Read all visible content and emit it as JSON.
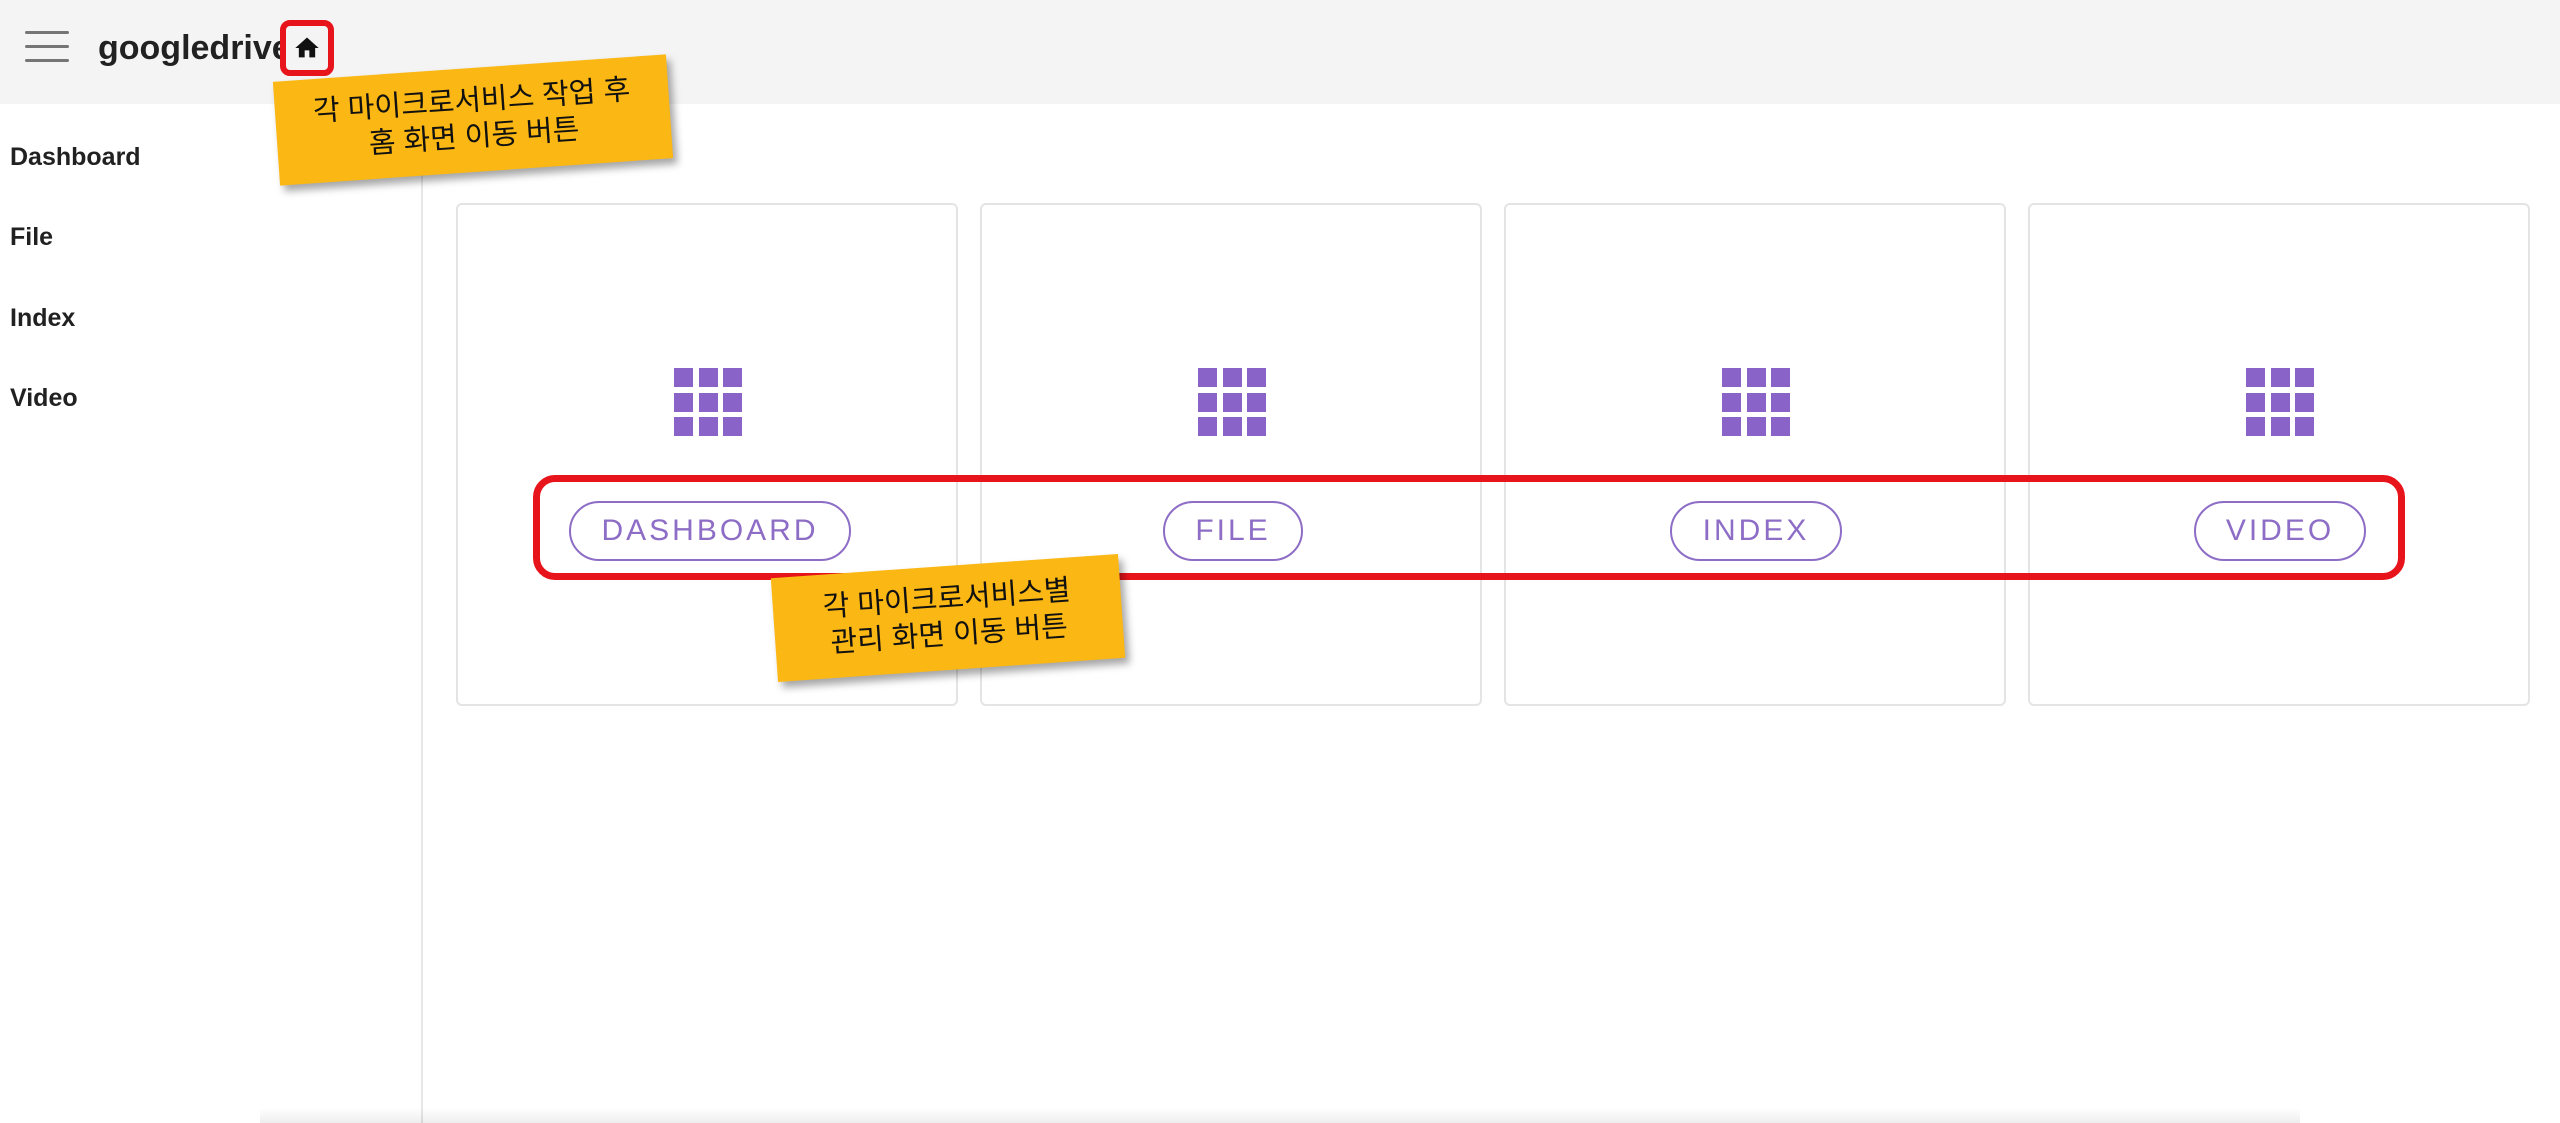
{
  "app": {
    "title": "googledrive"
  },
  "header": {
    "menu_icon": "hamburger-menu-icon",
    "home_icon": "home-icon"
  },
  "sidebar": {
    "items": [
      {
        "label": "Dashboard"
      },
      {
        "label": "File"
      },
      {
        "label": "Index"
      },
      {
        "label": "Video"
      }
    ]
  },
  "cards": [
    {
      "icon": "apps-grid-icon",
      "button_label": "DASHBOARD"
    },
    {
      "icon": "apps-grid-icon",
      "button_label": "FILE"
    },
    {
      "icon": "apps-grid-icon",
      "button_label": "INDEX"
    },
    {
      "icon": "apps-grid-icon",
      "button_label": "VIDEO"
    }
  ],
  "annotations": {
    "home_note": "각 마이크로서비스 작업 후\n홈 화면 이동 버튼",
    "cards_note": "각 마이크로서비스별\n관리 화면 이동 버튼"
  },
  "colors": {
    "accent": "#8a63c8",
    "highlight_frame": "#e8141b",
    "note_background": "#fbb713",
    "appbar_background": "#f4f4f4"
  }
}
